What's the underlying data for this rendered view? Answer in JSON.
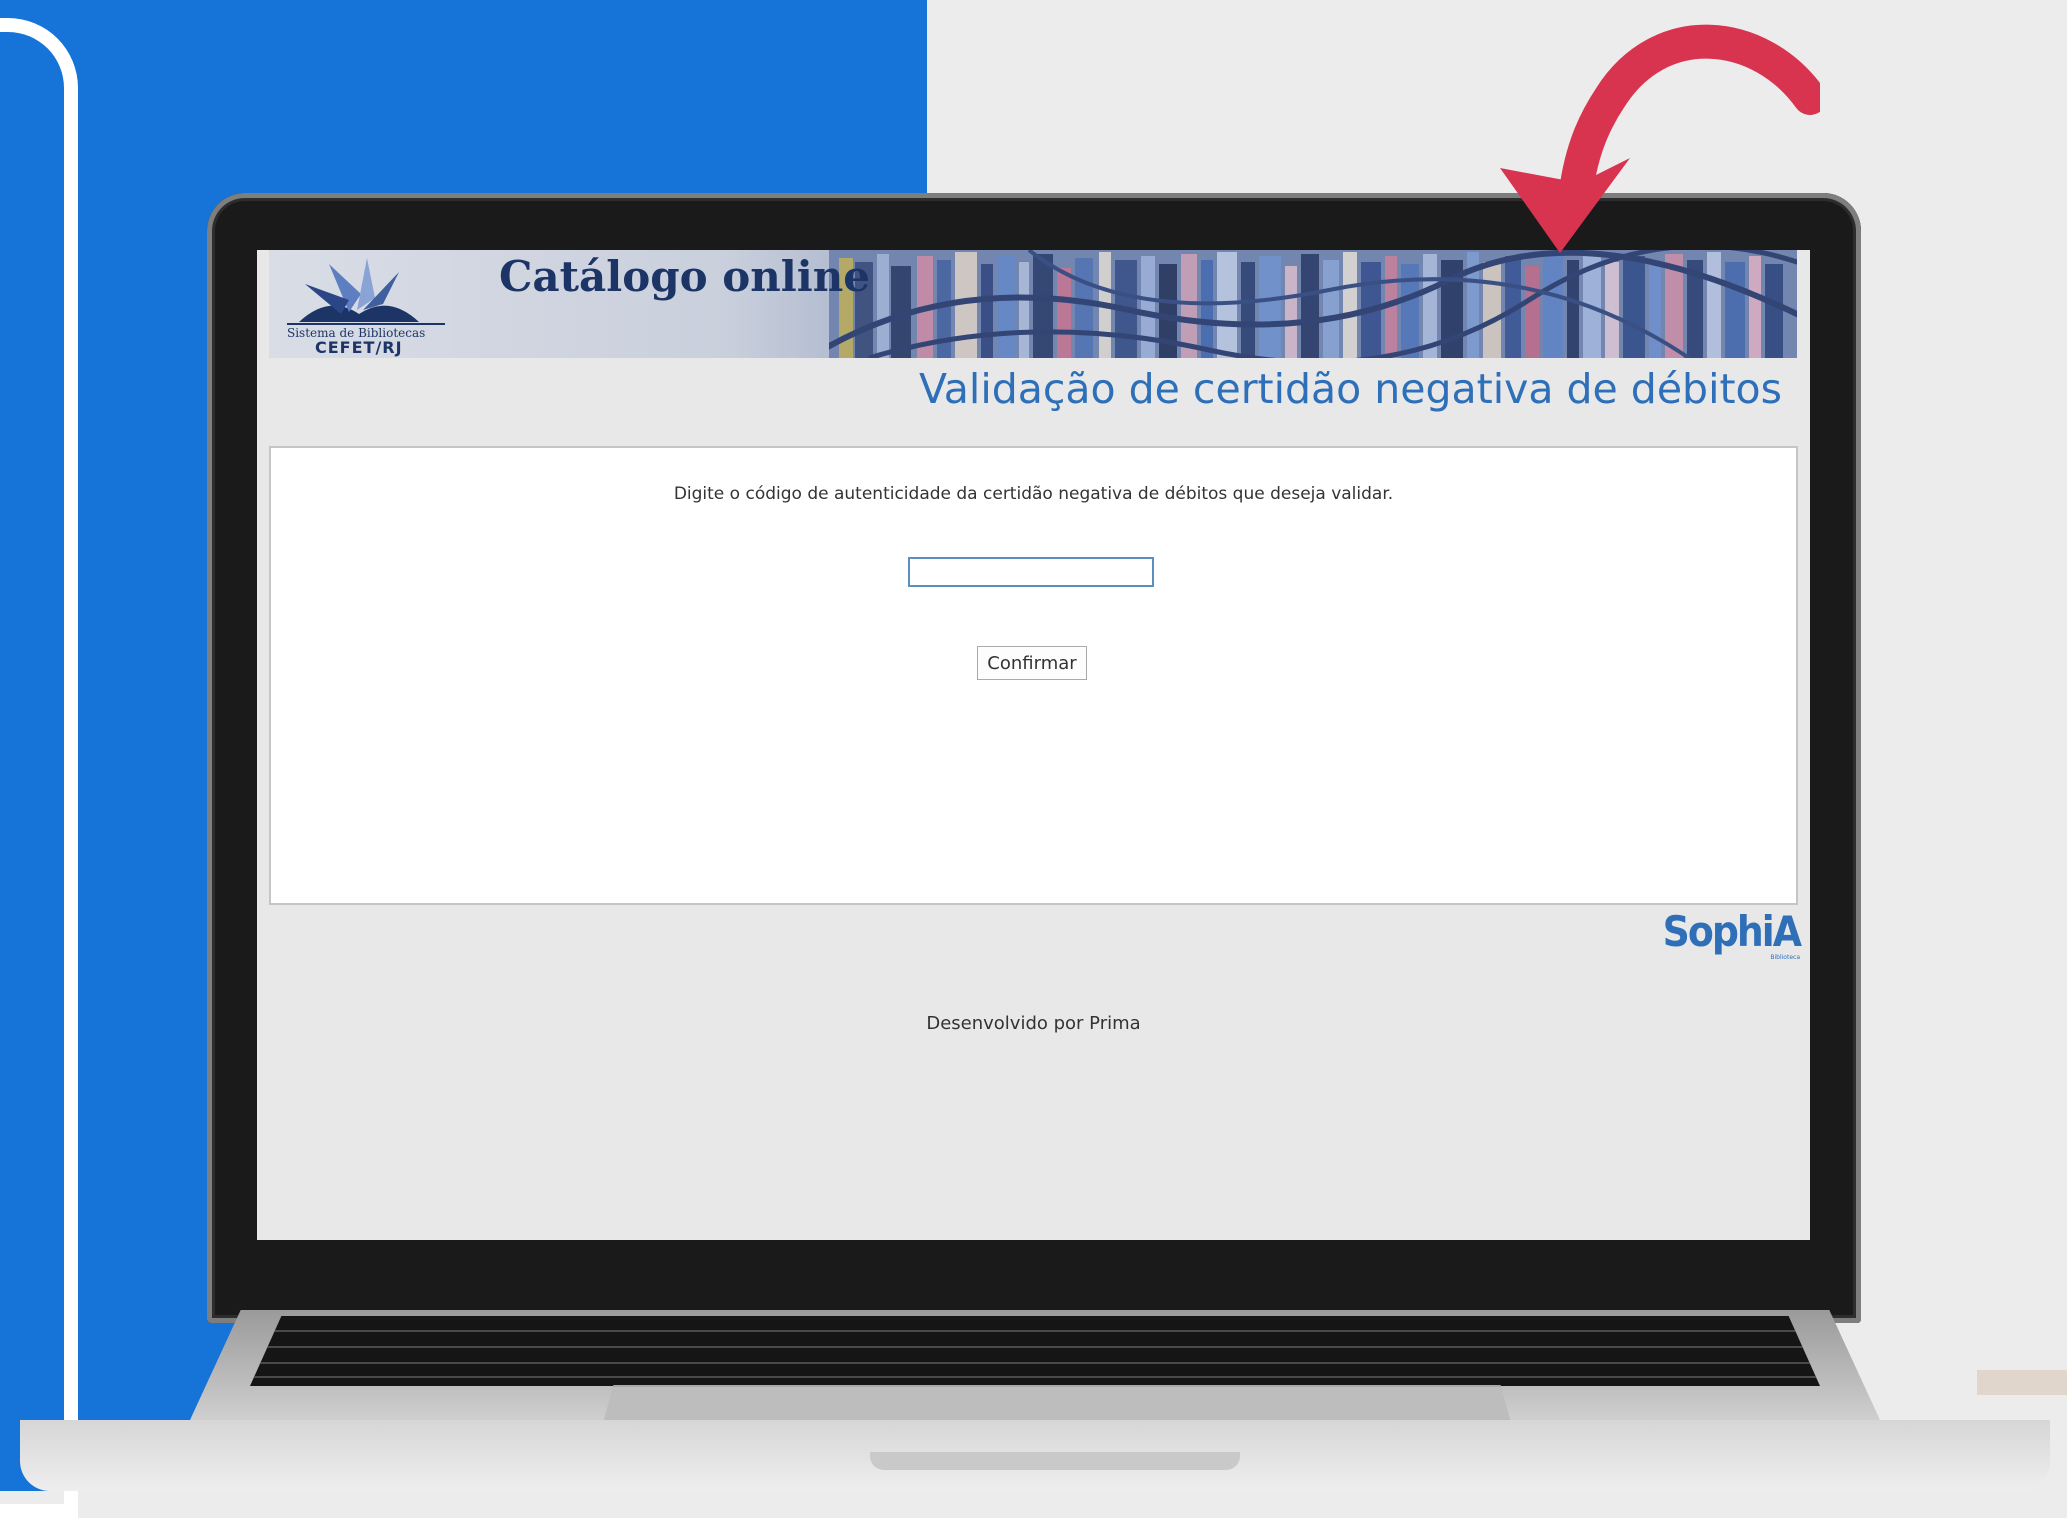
{
  "banner": {
    "title": "Catálogo online",
    "logo_line1": "Sistema de Bibliotecas",
    "logo_line2": "CEFET/RJ"
  },
  "page": {
    "title": "Validação de certidão negativa de débitos",
    "instructions": "Digite o código de autenticidade da certidão negativa de débitos que deseja validar.",
    "code_input_value": "",
    "confirm_label": "Confirmar"
  },
  "branding": {
    "name": "SophiA",
    "sub": "Biblioteca"
  },
  "footer": {
    "text": "Desenvolvido por Prima"
  },
  "decor": {
    "accent_blue": "#1674d9",
    "arrow_color": "#d9344f",
    "arrow_icon": "curved-arrow-icon"
  }
}
